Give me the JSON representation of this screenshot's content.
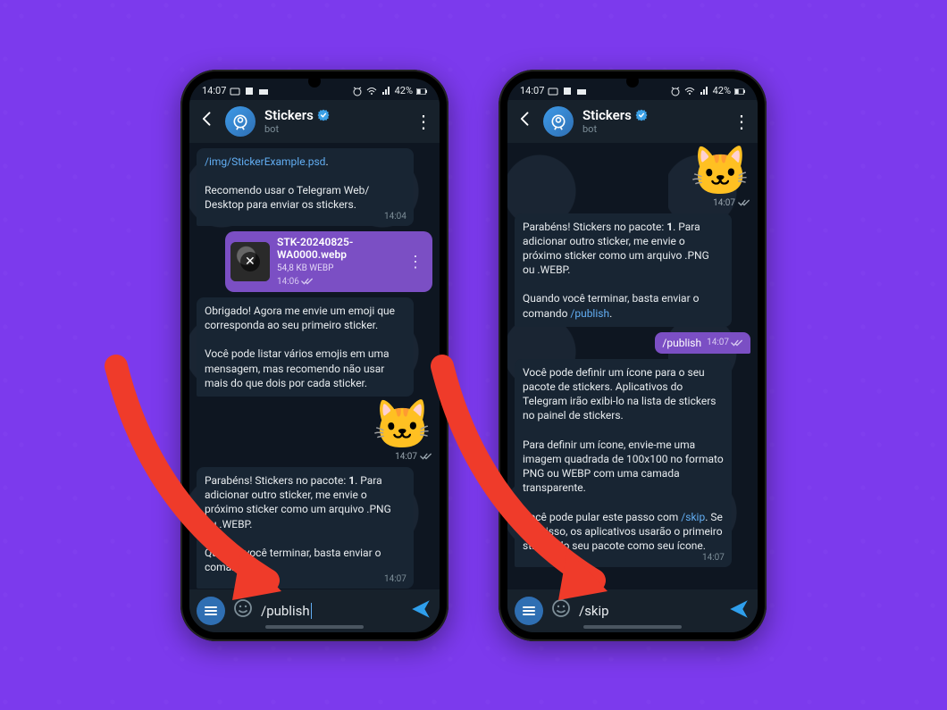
{
  "status": {
    "time": "14:07",
    "battery": "42%"
  },
  "header": {
    "name": "Stickers",
    "subtitle": "bot"
  },
  "phone1": {
    "link": "/img/StickerExample.psd",
    "intro": "Recomendo usar o Telegram Web/ Desktop para enviar os stickers.",
    "intro_ts": "14:04",
    "file": {
      "name": "STK-20240825-WA0000.webp",
      "size": "54,8 KB WEBP",
      "ts": "14:06"
    },
    "msg2_a": "Obrigado! Agora me envie um emoji que corresponda ao seu primeiro sticker.",
    "msg2_b": "Você pode listar vários emojis em uma mensagem, mas recomendo não usar mais do que dois por cada sticker.",
    "cat_ts": "14:07",
    "msg3_a_pre": "Parabéns! Stickers no pacote: ",
    "msg3_a_bold": "1",
    "msg3_a_post": ". Para adicionar outro sticker, me envie o próximo sticker como um arquivo .PNG ou .WEBP.",
    "msg3_b_pre": "Quando você terminar, basta enviar o comando ",
    "msg3_b_ts": "14:07",
    "input": "/publish"
  },
  "phone2": {
    "cat_ts": "14:07",
    "msg1_a_pre": "Parabéns! Stickers no pacote: ",
    "msg1_a_bold": "1",
    "msg1_a_post": ". Para adicionar outro sticker, me envie o próximo sticker como um arquivo .PNG ou .WEBP.",
    "msg1_b_pre": "Quando você terminar, basta enviar o comando ",
    "msg1_b_cmd": "/publish",
    "msg1_b_post": ".",
    "sent": "/publish",
    "sent_ts": "14:07",
    "msg2_a": "Você pode definir um ícone para o seu pacote de stickers. Aplicativos do Telegram irão exibi-lo na lista de stickers no painel de stickers.",
    "msg2_b": "Para definir um ícone, envie-me uma imagem quadrada de 100x100 no formato PNG ou WEBP com uma camada transparente.",
    "msg2_c_pre": "Você pode pular este passo com ",
    "msg2_c_cmd": "/skip",
    "msg2_c_post": ". Se fizer isso, os aplicativos usarão o primeiro sticker do seu pacote como seu ícone.",
    "msg2_ts": "14:07",
    "input": "/skip"
  }
}
